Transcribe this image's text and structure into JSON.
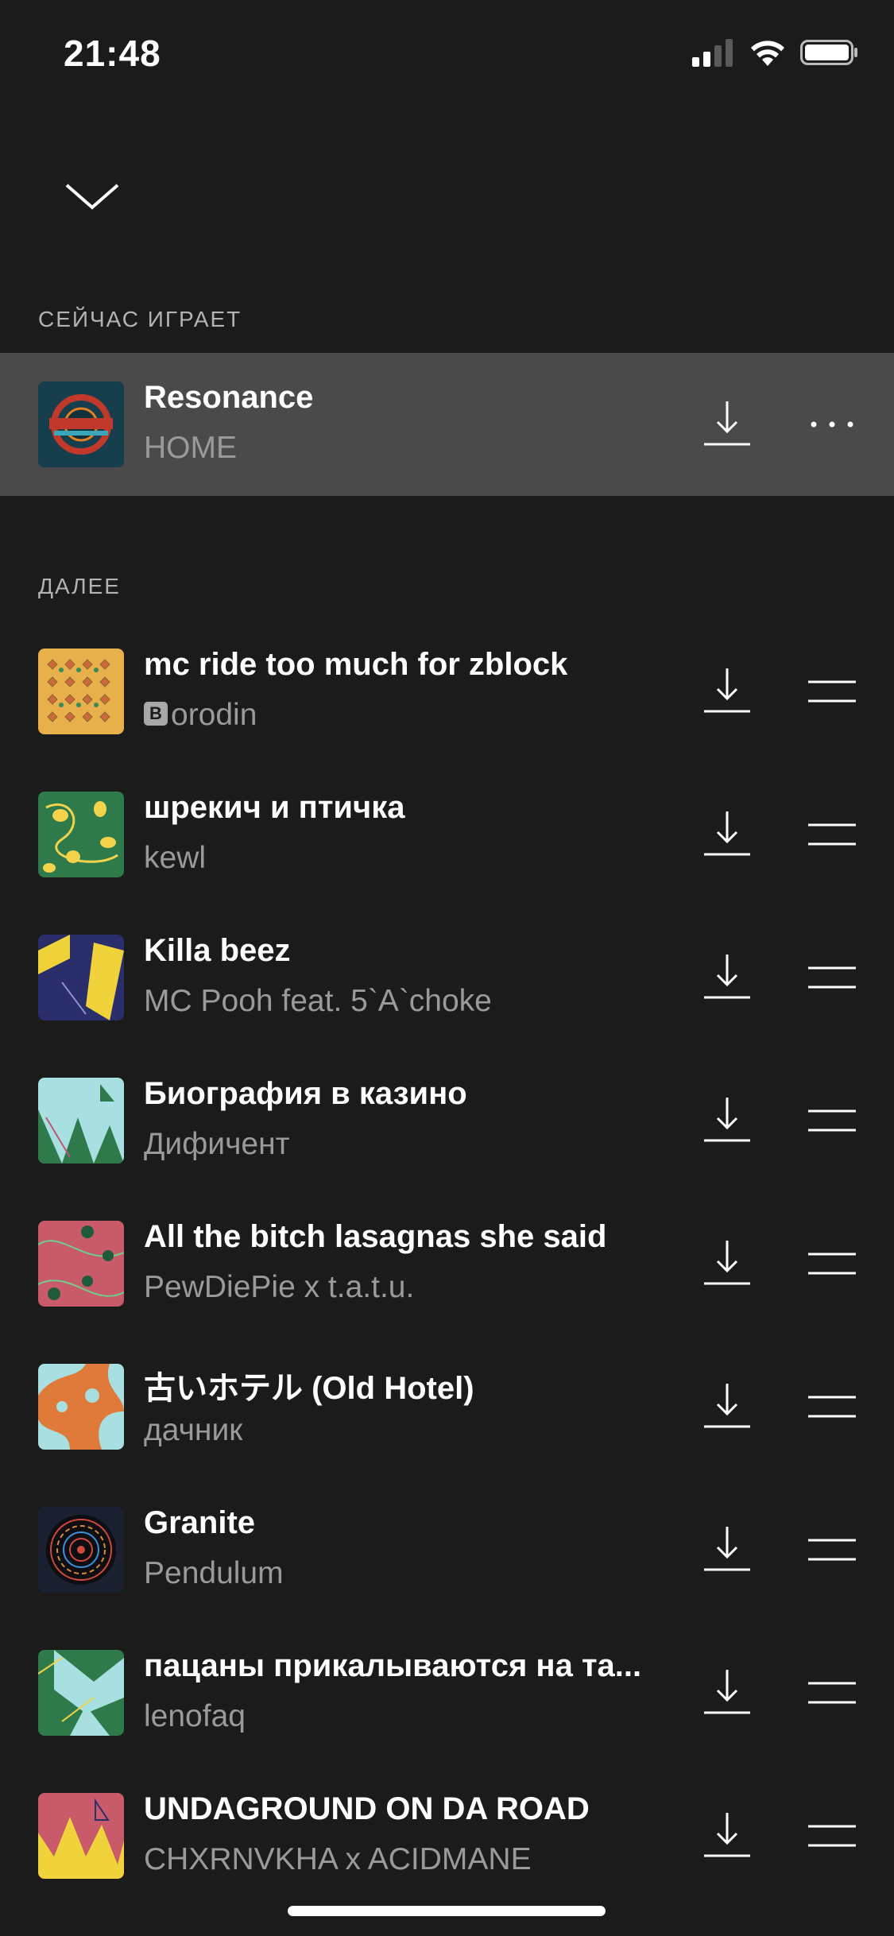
{
  "status": {
    "time": "21:48"
  },
  "sections": {
    "now_playing": "СЕЙЧАС ИГРАЕТ",
    "up_next": "ДАЛЕЕ"
  },
  "now_playing": {
    "title": "Resonance",
    "artist": "HOME"
  },
  "queue": [
    {
      "title": "mc ride too much for zblock",
      "artist_badge": "B",
      "artist": "orodin"
    },
    {
      "title": "шрекич и птичка",
      "artist": "kewl"
    },
    {
      "title": "Killa beez",
      "artist": "MC Pooh feat. 5`A`choke"
    },
    {
      "title": "Биография в казино",
      "artist": "Дифичент"
    },
    {
      "title": "All the bitch lasagnas she said",
      "artist": "PewDiePie x t.a.t.u."
    },
    {
      "title": " 古いホテル (Old Hotel)",
      "artist": "дачник"
    },
    {
      "title": "Granite",
      "artist": "Pendulum"
    },
    {
      "title": "пацаны прикалываются на та...",
      "artist": "lenofaq"
    },
    {
      "title": "UNDAGROUND ON DA ROAD",
      "artist": "CHXRNVKHA x ACIDMANE"
    }
  ],
  "colors": {
    "background": "#1b1b1b",
    "now_playing_bg": "#4a4a4a",
    "secondary_text": "#9a9a9a"
  }
}
